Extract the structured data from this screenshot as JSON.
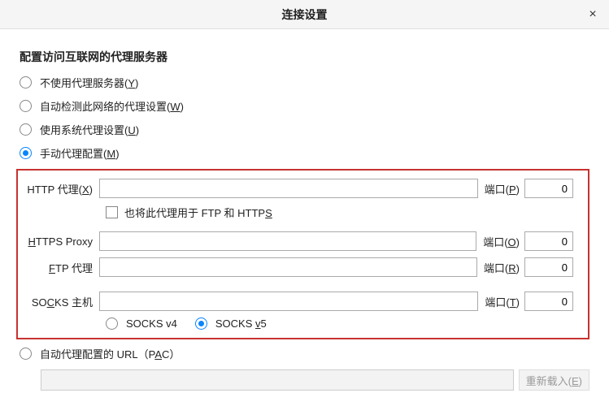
{
  "titlebar": {
    "title": "连接设置",
    "close": "×"
  },
  "section_title": "配置访问互联网的代理服务器",
  "radios": {
    "no_proxy_pre": "不使用代理服务器(",
    "no_proxy_u": "Y",
    "no_proxy_post": ")",
    "auto_detect_pre": "自动检测此网络的代理设置(",
    "auto_detect_u": "W",
    "auto_detect_post": ")",
    "system_pre": "使用系统代理设置(",
    "system_u": "U",
    "system_post": ")",
    "manual_pre": "手动代理配置(",
    "manual_u": "M",
    "manual_post": ")",
    "pac_pre": "自动代理配置的 URL（P",
    "pac_u": "A",
    "pac_post": "C）"
  },
  "fields": {
    "http_label_pre": "HTTP 代理(",
    "http_label_u": "X",
    "http_label_post": ")",
    "http_port_label_pre": "端口(",
    "http_port_label_u": "P",
    "http_port_label_post": ")",
    "http_port_value": "0",
    "also_use_pre": "也将此代理用于 FTP 和 HTTP",
    "also_use_u": "S",
    "https_label_u": "H",
    "https_label_post": "TTPS Proxy",
    "https_port_label_pre": "端口(",
    "https_port_label_u": "O",
    "https_port_label_post": ")",
    "https_port_value": "0",
    "ftp_label_u": "F",
    "ftp_label_post": "TP 代理",
    "ftp_port_label_pre": "端口(",
    "ftp_port_label_u": "R",
    "ftp_port_label_post": ")",
    "ftp_port_value": "0",
    "socks_label_pre": "SO",
    "socks_label_u": "C",
    "socks_label_post": "KS 主机",
    "socks_port_label_pre": "端口(",
    "socks_port_label_u": "T",
    "socks_port_label_post": ")",
    "socks_port_value": "0",
    "socks_v4": "SOCKS v4",
    "socks_v5_pre": "SOCKS ",
    "socks_v5_u": "v",
    "socks_v5_post": "5"
  },
  "reload_pre": "重新载入(",
  "reload_u": "E",
  "reload_post": ")"
}
